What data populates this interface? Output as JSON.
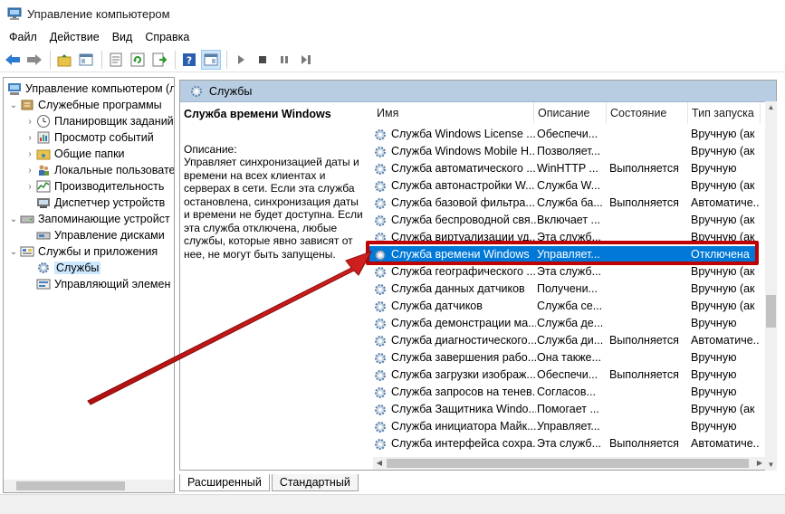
{
  "window": {
    "title": "Управление компьютером"
  },
  "menu": [
    "Файл",
    "Действие",
    "Вид",
    "Справка"
  ],
  "tree": {
    "root": "Управление компьютером (л",
    "system_tools": "Служебные программы",
    "task_scheduler": "Планировщик заданий",
    "event_viewer": "Просмотр событий",
    "shared_folders": "Общие папки",
    "local_users": "Локальные пользовате",
    "performance": "Производительность",
    "device_manager": "Диспетчер устройств",
    "storage": "Запоминающие устройст",
    "disk_management": "Управление дисками",
    "services_apps": "Службы и приложения",
    "services": "Службы",
    "wmi": "Управляющий элемен"
  },
  "panel": {
    "title": "Службы"
  },
  "description": {
    "service_name": "Служба времени Windows",
    "label": "Описание:",
    "text": "Управляет синхронизацией даты и времени на всех клиентах и серверах в сети. Если эта служба остановлена, синхронизация даты и времени не будет доступна. Если эта служба отключена, любые службы, которые явно зависят от нее, не могут быть запущены."
  },
  "columns": {
    "name": "Имя",
    "description": "Описание",
    "state": "Состояние",
    "startup": "Тип запуска"
  },
  "services": [
    {
      "name": "Служба Windows License ...",
      "desc": "Обеспечи...",
      "state": "",
      "start": "Вручную (ак"
    },
    {
      "name": "Служба Windows Mobile H...",
      "desc": "Позволяет...",
      "state": "",
      "start": "Вручную (ак"
    },
    {
      "name": "Служба автоматического ...",
      "desc": "WinHTTP ...",
      "state": "Выполняется",
      "start": "Вручную"
    },
    {
      "name": "Служба автонастройки W...",
      "desc": "Служба W...",
      "state": "",
      "start": "Вручную (ак"
    },
    {
      "name": "Служба базовой фильтра...",
      "desc": "Служба ба...",
      "state": "Выполняется",
      "start": "Автоматиче..."
    },
    {
      "name": "Служба беспроводной свя...",
      "desc": "Включает ...",
      "state": "",
      "start": "Вручную (ак"
    },
    {
      "name": "Служба виртуализации уд...",
      "desc": "Эта служб...",
      "state": "",
      "start": "Вручную (ак"
    },
    {
      "name": "Служба времени Windows",
      "desc": "Управляет...",
      "state": "",
      "start": "Отключена"
    },
    {
      "name": "Служба географического ...",
      "desc": "Эта служб...",
      "state": "",
      "start": "Вручную (ак"
    },
    {
      "name": "Служба данных датчиков",
      "desc": "Получени...",
      "state": "",
      "start": "Вручную (ак"
    },
    {
      "name": "Служба датчиков",
      "desc": "Служба се...",
      "state": "",
      "start": "Вручную (ак"
    },
    {
      "name": "Служба демонстрации ма...",
      "desc": "Служба де...",
      "state": "",
      "start": "Вручную"
    },
    {
      "name": "Служба диагностического...",
      "desc": "Служба ди...",
      "state": "Выполняется",
      "start": "Автоматиче..."
    },
    {
      "name": "Служба завершения рабо...",
      "desc": "Она тaкже...",
      "state": "",
      "start": "Вручную"
    },
    {
      "name": "Служба загрузки изображ...",
      "desc": "Обеспечи...",
      "state": "Выполняется",
      "start": "Вручную"
    },
    {
      "name": "Служба запросов на тенев...",
      "desc": "Согласов...",
      "state": "",
      "start": "Вручную"
    },
    {
      "name": "Служба Защитника Windo...",
      "desc": "Помогает ...",
      "state": "",
      "start": "Вручную (ак"
    },
    {
      "name": "Служба инициатора Майк...",
      "desc": "Управляет...",
      "state": "",
      "start": "Вручную"
    },
    {
      "name": "Служба интерфейса сохра...",
      "desc": "Эта служб...",
      "state": "Выполняется",
      "start": "Автоматиче..."
    }
  ],
  "tabs": {
    "extended": "Расширенный",
    "standard": "Стандартный"
  }
}
